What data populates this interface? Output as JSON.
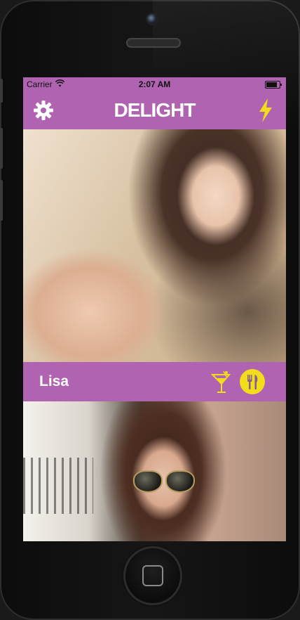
{
  "theme": {
    "accent": "#b063b1",
    "yellow": "#f2dd1b",
    "text": "#ffffff"
  },
  "status_bar": {
    "carrier": "Carrier",
    "time": "2:07 AM",
    "wifi_icon": "wifi-icon",
    "battery_icon": "battery-icon"
  },
  "nav_bar": {
    "title": "DELIGHT",
    "left_icon": "gear-icon",
    "right_icon": "lightning-bolt-icon"
  },
  "cards": [
    {
      "name": "Lisa",
      "actions": [
        {
          "icon": "cocktail-glass-icon"
        },
        {
          "icon": "fork-knife-icon"
        }
      ]
    }
  ],
  "device": {
    "home_button_icon": "home-square-icon"
  }
}
